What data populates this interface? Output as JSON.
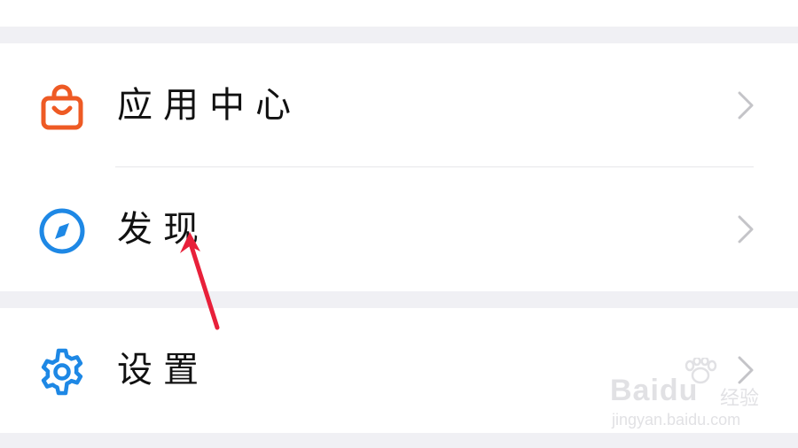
{
  "settings_list": {
    "items": [
      {
        "label": "应用中心",
        "icon": "shopping-bag-icon",
        "icon_color": "#ee5a24"
      },
      {
        "label": "发现",
        "icon": "compass-icon",
        "icon_color": "#1e88e5"
      },
      {
        "label": "设置",
        "icon": "gear-icon",
        "icon_color": "#1e88e5"
      }
    ],
    "chevron_color": "#c4c4c8"
  },
  "annotation": {
    "arrow_color": "#e8203a",
    "points_to": "发现"
  },
  "watermark": {
    "brand": "Baidu",
    "sub": "经验",
    "url": "jingyan.baidu.com"
  }
}
